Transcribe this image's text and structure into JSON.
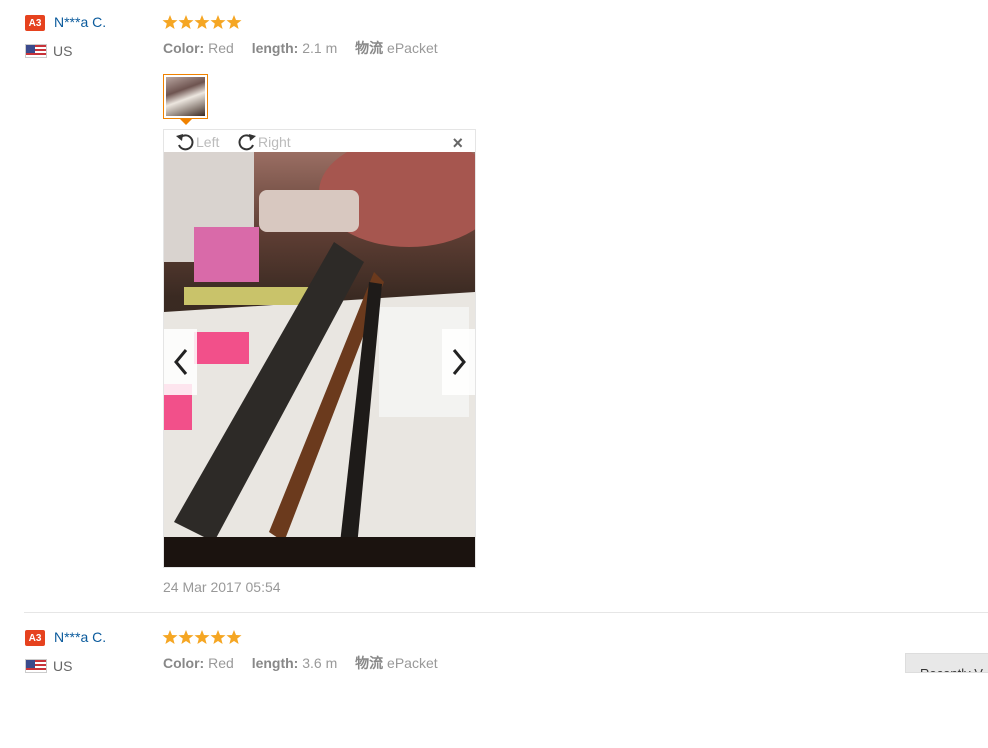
{
  "reviews": [
    {
      "badge": "A3",
      "name": "N***a C.",
      "country": "US",
      "rating": 5,
      "color_label": "Color:",
      "color_value": "Red",
      "length_label": "length:",
      "length_value": "2.1 m",
      "ship_label": "物流",
      "ship_value": "ePacket",
      "date": "24 Mar 2017 05:54"
    },
    {
      "badge": "A3",
      "name": "N***a C.",
      "country": "US",
      "rating": 5,
      "color_label": "Color:",
      "color_value": "Red",
      "length_label": "length:",
      "length_value": "3.6 m",
      "ship_label": "物流",
      "ship_value": "ePacket"
    }
  ],
  "viewer": {
    "rotate_left": "Left",
    "rotate_right": "Right",
    "close": "×"
  },
  "recently_viewed": "Recently V",
  "colors": {
    "accent": "#f08200",
    "star": "#f5a623",
    "name": "#0a5a9c",
    "badge": "#e6421e"
  }
}
